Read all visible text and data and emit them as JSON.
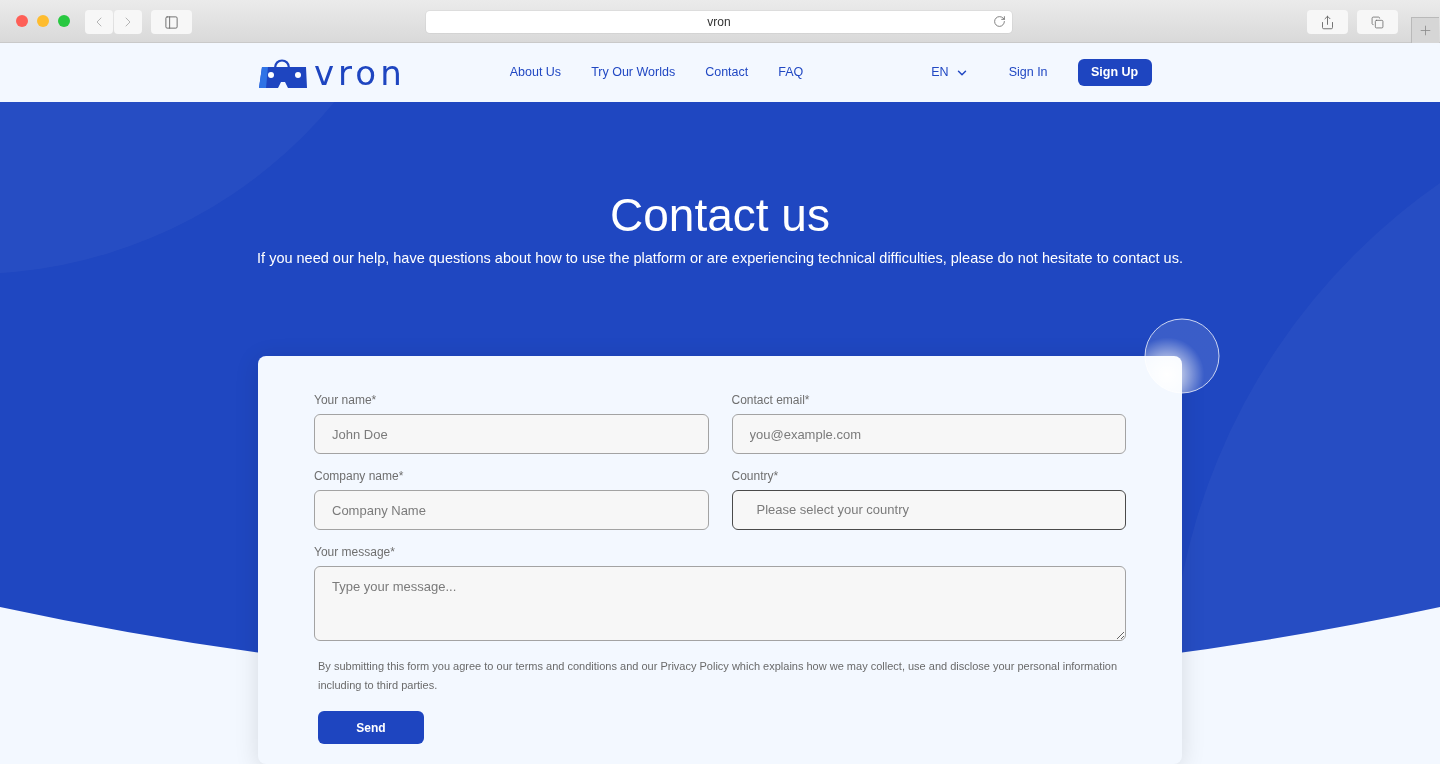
{
  "browser": {
    "address": "vron"
  },
  "nav": {
    "logo_text": "vron",
    "links": [
      {
        "label": "About Us"
      },
      {
        "label": "Try Our Worlds"
      },
      {
        "label": "Contact"
      },
      {
        "label": "FAQ"
      }
    ],
    "language": "EN",
    "sign_in": "Sign In",
    "sign_up": "Sign Up"
  },
  "hero": {
    "title": "Contact us",
    "subtitle": "If you need our help, have questions about how to use the platform or are experiencing technical difficulties, please do not hesitate to contact us."
  },
  "form": {
    "fields": [
      {
        "label": "Your name*",
        "placeholder": "John Doe",
        "kind": "input"
      },
      {
        "label": "Contact email*",
        "placeholder": "you@example.com",
        "kind": "input"
      },
      {
        "label": "Company name*",
        "placeholder": "Company Name",
        "kind": "input"
      },
      {
        "label": "Country*",
        "placeholder": "Please select your country",
        "kind": "select"
      },
      {
        "label": "Your message*",
        "placeholder": "Type your message...",
        "kind": "textarea"
      }
    ],
    "notice": "By submitting this form you agree to our terms and conditions and our Privacy Policy which explains how we may collect, use and disclose your personal information including to third parties.",
    "submit": "Send"
  }
}
